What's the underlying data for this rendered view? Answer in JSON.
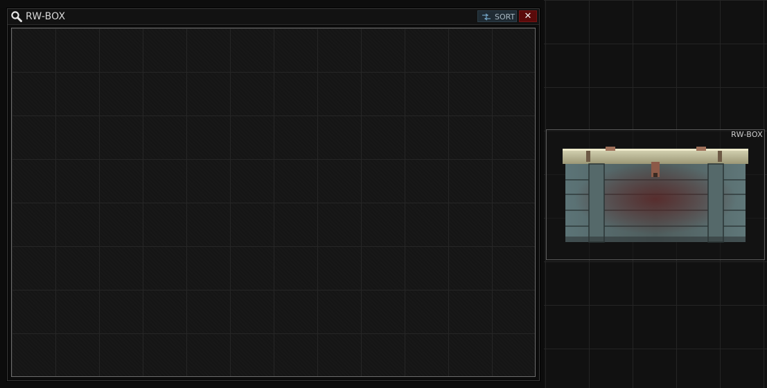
{
  "window": {
    "title": "RW-BOX",
    "sort_label": "SORT",
    "close_label": "✕",
    "icons": {
      "search": "search-icon",
      "sort": "sort-icon",
      "close": "close-icon"
    }
  },
  "stash": {
    "item": {
      "short_name": "RW-BOX",
      "icon": "wooden-crate-icon"
    }
  },
  "colors": {
    "close_button": "#5a0a0a",
    "sort_button": "#1f2b33",
    "grid_line": "#262626",
    "panel_bg": "#151515"
  }
}
